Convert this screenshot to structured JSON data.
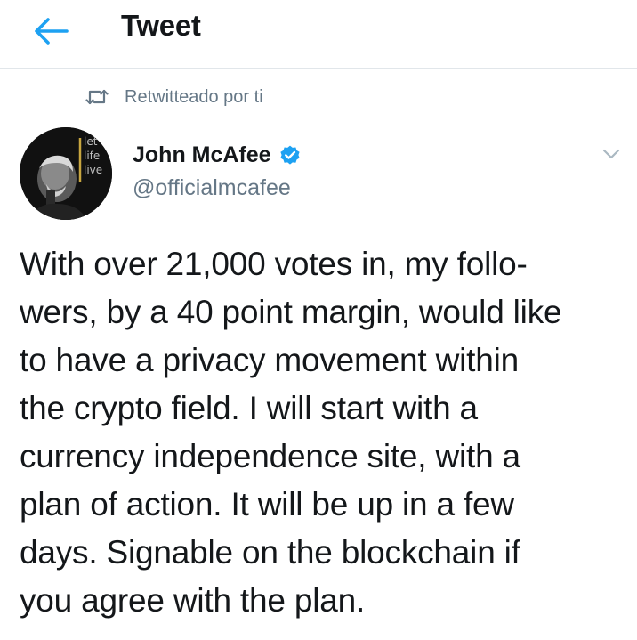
{
  "header": {
    "back_icon": "arrow-left-icon",
    "title": "Tweet",
    "accent_color": "#1da1f2"
  },
  "retweet_context": {
    "icon": "retweet-icon",
    "text": "Retwitteado por ti"
  },
  "tweet": {
    "author": {
      "name": "John McAfee",
      "handle": "@officialmcafee",
      "verified": true,
      "avatar_text": [
        "let",
        "life",
        "live"
      ]
    },
    "menu_icon": "chevron-down-icon",
    "body_lines": [
      "With over 21,000 votes in, my follo-",
      "wers, by a 40 point margin, would like",
      "to have a privacy movement within",
      "the crypto field. I will start with a",
      "currency independence site, with a",
      "plan of action. It will be up in a few",
      "days. Signable on the blockchain if",
      "you agree with the plan."
    ]
  }
}
